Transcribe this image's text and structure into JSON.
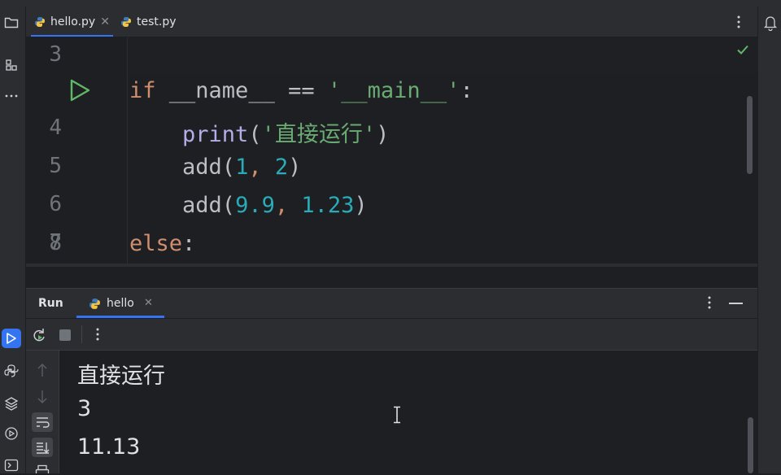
{
  "tabs": [
    {
      "label": "hello.py",
      "active": true,
      "closable": true
    },
    {
      "label": "test.py",
      "active": false,
      "closable": false
    }
  ],
  "editor": {
    "lines": [
      {
        "number": "3"
      },
      {
        "number": "4"
      },
      {
        "number": "5"
      },
      {
        "number": "6"
      },
      {
        "number": "7"
      },
      {
        "number": "8"
      }
    ],
    "code": {
      "l4_if": "if",
      "l4_name": "__name__",
      "l4_eq": "==",
      "l4_str": "'__main__'",
      "l4_colon": ":",
      "l5_fn": "print",
      "l5_open": "(",
      "l5_str": "'直接运行'",
      "l5_close": ")",
      "l6_fn": "add(",
      "l6_a": "1",
      "l6_comma": ", ",
      "l6_b": "2",
      "l6_close": ")",
      "l7_fn": "add(",
      "l7_a": "9.9",
      "l7_comma": ", ",
      "l7_b": "1.23",
      "l7_close": ")",
      "l8_else": "else",
      "l8_colon": ":"
    }
  },
  "run_panel": {
    "title": "Run",
    "tab_label": "hello",
    "output": [
      "直接运行",
      "3",
      "11.13"
    ]
  },
  "icons": {
    "left_bar": [
      "folder-icon",
      "structure-icon",
      "more-icon",
      "run-icon",
      "python-console-icon",
      "layers-icon",
      "services-icon",
      "terminal-icon"
    ],
    "right_bar": [
      "notifications-icon"
    ]
  },
  "colors": {
    "accent": "#3574f0",
    "keyword": "#cf8e6d",
    "string": "#6aab73",
    "number": "#2aacb8",
    "function": "#b3ade8",
    "run_green": "#5fb865"
  }
}
